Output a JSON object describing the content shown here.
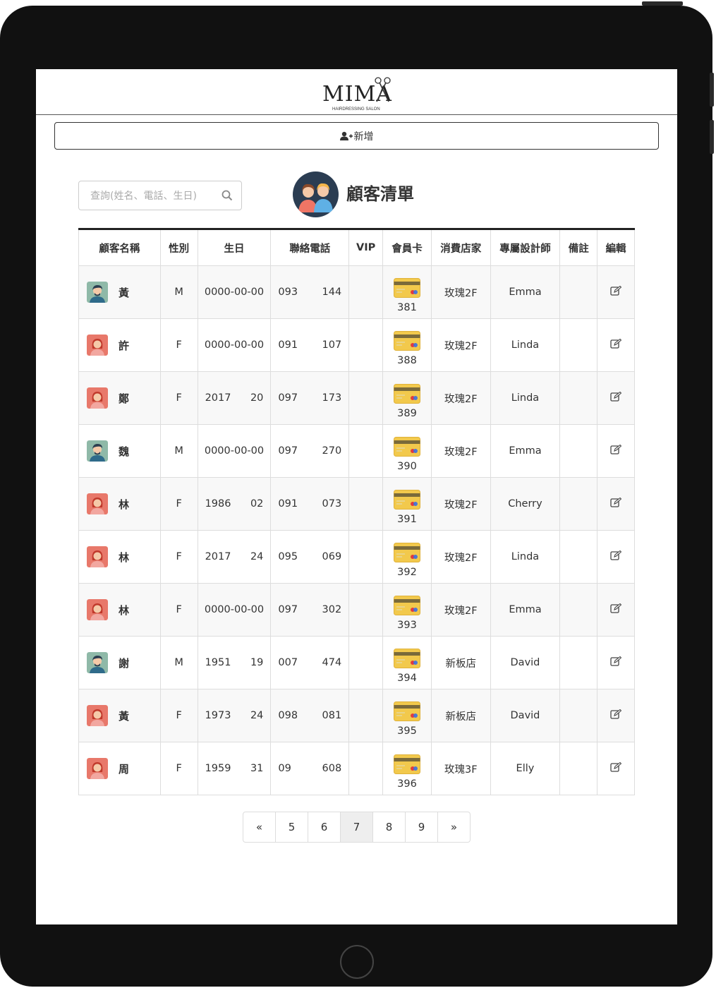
{
  "app": {
    "logo_text": "MIMA",
    "logo_subtext": "HAIRDRESSING SALON"
  },
  "toolbar": {
    "add_label": "新增"
  },
  "search": {
    "placeholder": "查詢(姓名、電話、生日)"
  },
  "page": {
    "title": "顧客清單"
  },
  "table": {
    "headers": [
      "顧客名稱",
      "性別",
      "生日",
      "聯絡電話",
      "VIP",
      "會員卡",
      "消費店家",
      "專屬設計師",
      "備註",
      "編輯"
    ],
    "rows": [
      {
        "avatar": "male",
        "name": "黃",
        "gender": "M",
        "birthday_a": "0000-00-00",
        "birthday_b": "",
        "phone_a": "093",
        "phone_b": "144",
        "vip": "",
        "card_no": "381",
        "store": "玫瑰2F",
        "designer": "Emma",
        "note": ""
      },
      {
        "avatar": "female",
        "name": "許",
        "gender": "F",
        "birthday_a": "0000-00-00",
        "birthday_b": "",
        "phone_a": "091",
        "phone_b": "107",
        "vip": "",
        "card_no": "388",
        "store": "玫瑰2F",
        "designer": "Linda",
        "note": ""
      },
      {
        "avatar": "female",
        "name": "鄭",
        "gender": "F",
        "birthday_a": "2017",
        "birthday_b": "20",
        "phone_a": "097",
        "phone_b": "173",
        "vip": "",
        "card_no": "389",
        "store": "玫瑰2F",
        "designer": "Linda",
        "note": ""
      },
      {
        "avatar": "male",
        "name": "魏",
        "gender": "M",
        "birthday_a": "0000-00-00",
        "birthday_b": "",
        "phone_a": "097",
        "phone_b": "270",
        "vip": "",
        "card_no": "390",
        "store": "玫瑰2F",
        "designer": "Emma",
        "note": ""
      },
      {
        "avatar": "female",
        "name": "林",
        "gender": "F",
        "birthday_a": "1986",
        "birthday_b": "02",
        "phone_a": "091",
        "phone_b": "073",
        "vip": "",
        "card_no": "391",
        "store": "玫瑰2F",
        "designer": "Cherry",
        "note": ""
      },
      {
        "avatar": "female",
        "name": "林",
        "gender": "F",
        "birthday_a": "2017",
        "birthday_b": "24",
        "phone_a": "095",
        "phone_b": "069",
        "vip": "",
        "card_no": "392",
        "store": "玫瑰2F",
        "designer": "Linda",
        "note": ""
      },
      {
        "avatar": "female",
        "name": "林",
        "gender": "F",
        "birthday_a": "0000-00-00",
        "birthday_b": "",
        "phone_a": "097",
        "phone_b": "302",
        "vip": "",
        "card_no": "393",
        "store": "玫瑰2F",
        "designer": "Emma",
        "note": ""
      },
      {
        "avatar": "male",
        "name": "謝",
        "gender": "M",
        "birthday_a": "1951",
        "birthday_b": "19",
        "phone_a": "007",
        "phone_b": "474",
        "vip": "",
        "card_no": "394",
        "store": "新板店",
        "designer": "David",
        "note": ""
      },
      {
        "avatar": "female",
        "name": "黃",
        "gender": "F",
        "birthday_a": "1973",
        "birthday_b": "24",
        "phone_a": "098",
        "phone_b": "081",
        "vip": "",
        "card_no": "395",
        "store": "新板店",
        "designer": "David",
        "note": ""
      },
      {
        "avatar": "female",
        "name": "周",
        "gender": "F",
        "birthday_a": "1959",
        "birthday_b": "31",
        "phone_a": "09",
        "phone_b": "608",
        "vip": "",
        "card_no": "396",
        "store": "玫瑰3F",
        "designer": "Elly",
        "note": ""
      }
    ]
  },
  "pagination": {
    "first": "«",
    "pages": [
      "5",
      "6",
      "7",
      "8",
      "9"
    ],
    "current": "7",
    "last": "»"
  },
  "colors": {
    "card_gold": "#f2c94c",
    "device": "#111111",
    "avatar_male_bg": "#8fb9a8",
    "avatar_female_bg": "#e8786a"
  }
}
